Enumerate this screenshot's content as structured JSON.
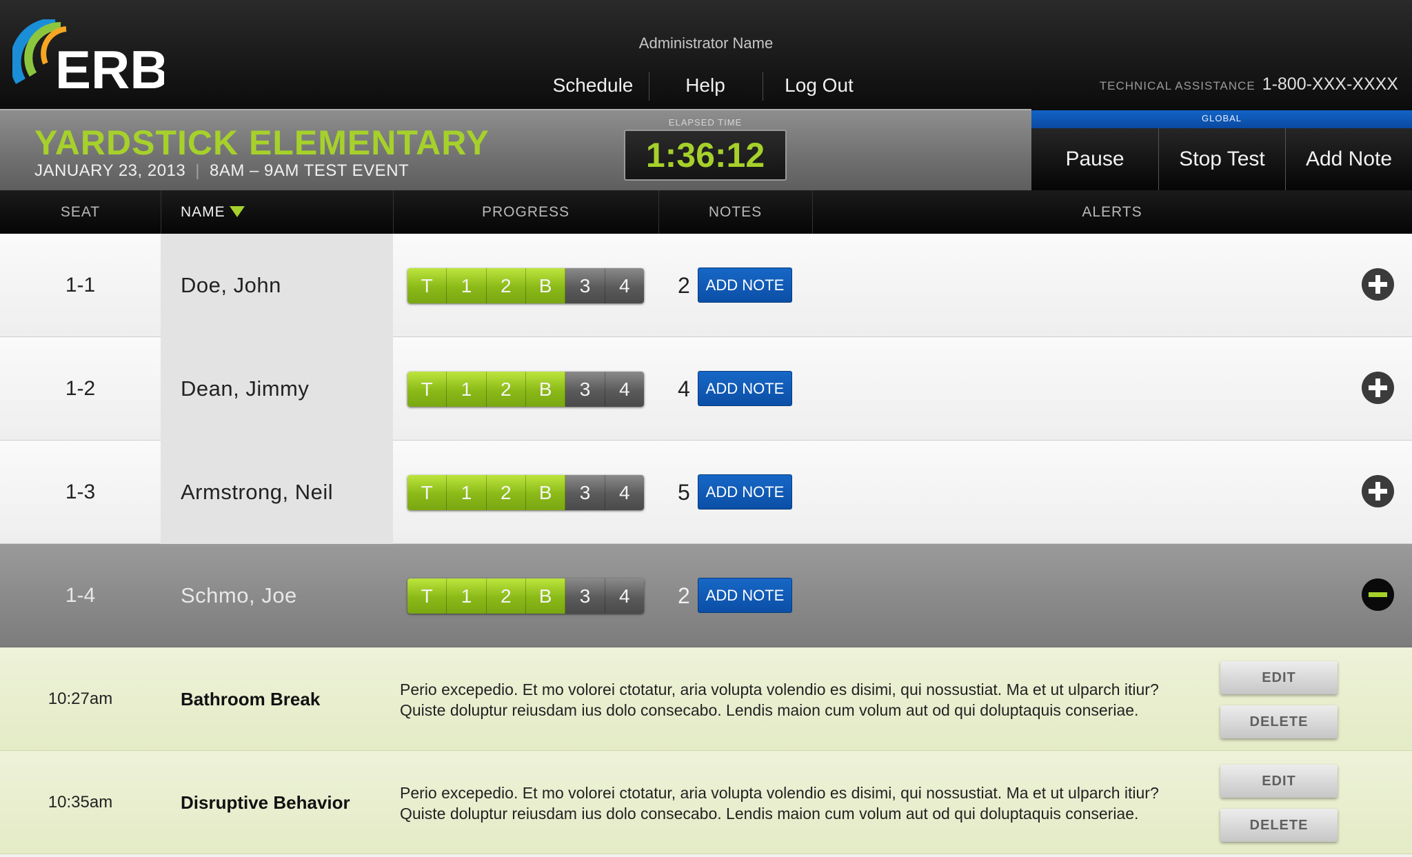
{
  "header": {
    "logo_text": "ERB",
    "admin_name": "Administrator Name",
    "nav": [
      {
        "label": "Schedule"
      },
      {
        "label": "Help"
      },
      {
        "label": "Log Out"
      }
    ],
    "tech_label": "TECHNICAL ASSISTANCE",
    "tech_phone": "1-800-XXX-XXXX"
  },
  "event": {
    "school": "YARDSTICK ELEMENTARY",
    "date": "JANUARY 23, 2013",
    "time": "8AM – 9AM TEST EVENT",
    "elapsed_label": "ELAPSED TIME",
    "elapsed_time": "1:36:12"
  },
  "global": {
    "label": "GLOBAL",
    "buttons": [
      {
        "label": "Pause"
      },
      {
        "label": "Stop Test"
      },
      {
        "label": "Add Note"
      }
    ]
  },
  "columns": [
    "SEAT",
    "NAME",
    "PROGRESS",
    "NOTES",
    "ALERTS"
  ],
  "progress_segments": [
    "T",
    "1",
    "2",
    "B",
    "3",
    "4"
  ],
  "add_note_label": "ADD NOTE",
  "students": [
    {
      "seat": "1-1",
      "name": "Doe, John",
      "completed": 4,
      "notes": "2",
      "expanded": false
    },
    {
      "seat": "1-2",
      "name": "Dean, Jimmy",
      "completed": 4,
      "notes": "4",
      "expanded": false
    },
    {
      "seat": "1-3",
      "name": "Armstrong, Neil",
      "completed": 4,
      "notes": "5",
      "expanded": false
    },
    {
      "seat": "1-4",
      "name": "Schmo, Joe",
      "completed": 4,
      "notes": "2",
      "expanded": true
    }
  ],
  "notes": [
    {
      "time": "10:27am",
      "title": "Bathroom Break",
      "line1": "Perio excepedio. Et mo volorei ctotatur, aria volupta volendio es disimi, qui nossustiat. Ma et ut ulparch itiur?",
      "line2": "Quiste doluptur reiusdam ius dolo consecabo. Lendis maion cum volum aut od qui doluptaquis conseriae.",
      "edit_label": "EDIT",
      "delete_label": "DELETE"
    },
    {
      "time": "10:35am",
      "title": "Disruptive Behavior",
      "line1": "Perio excepedio. Et mo volorei ctotatur, aria volupta volendio es disimi, qui nossustiat. Ma et ut ulparch itiur?",
      "line2": "Quiste doluptur reiusdam ius dolo consecabo. Lendis maion cum volum aut od qui doluptaquis conseriae.",
      "edit_label": "EDIT",
      "delete_label": "DELETE"
    }
  ],
  "colors": {
    "accent_green": "#a6d12b",
    "button_blue": "#0b4fa6",
    "note_bg": "#e8eecf"
  }
}
